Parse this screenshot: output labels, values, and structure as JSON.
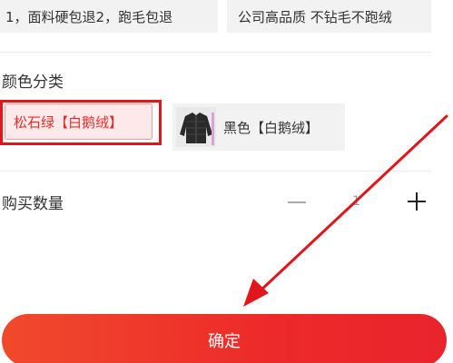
{
  "review_tags": [
    "1，面料硬包退2，跑毛包退",
    "公司高品质 不钻毛不跑绒"
  ],
  "color_section": {
    "label": "颜色分类",
    "options": [
      {
        "label": "松石绿【白鹅绒】",
        "selected": true
      },
      {
        "label": "黑色【白鹅绒】",
        "selected": false,
        "thumbnail": "black-down-jacket-image"
      }
    ]
  },
  "quantity_section": {
    "label": "购买数量",
    "value": "1"
  },
  "confirm_button": {
    "label": "确定"
  },
  "colors": {
    "accent_red": "#e9242d",
    "highlight_red": "#e0161b",
    "selected_bg": "#fde9e9",
    "chip_bg": "#f2f2f2"
  }
}
